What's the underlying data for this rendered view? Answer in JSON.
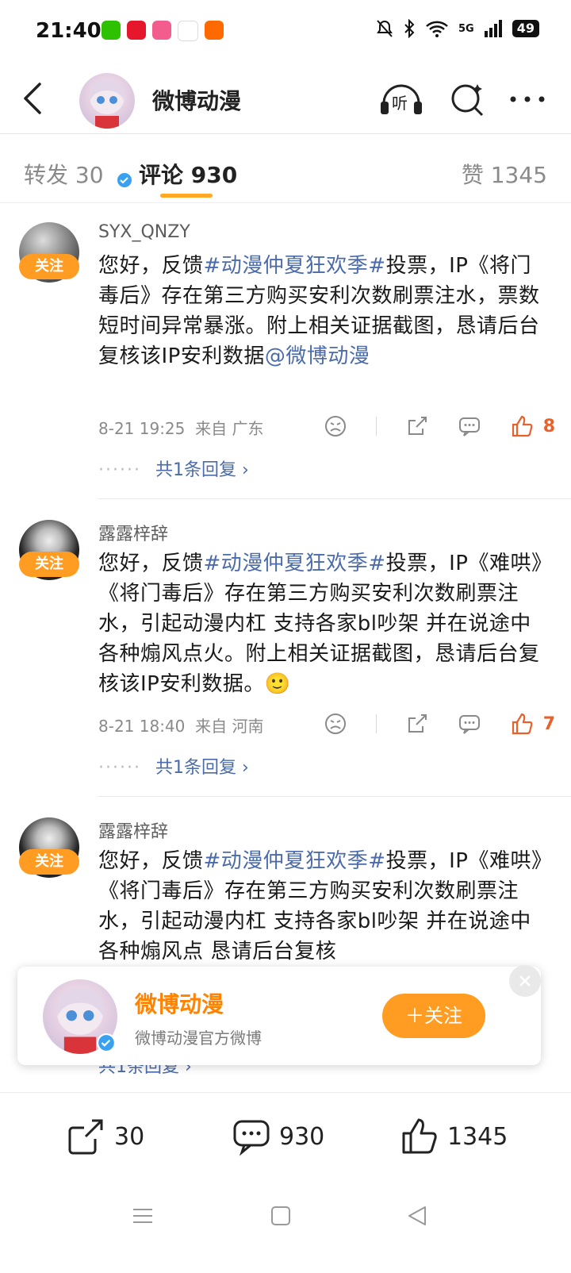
{
  "status_bar": {
    "time": "21:40",
    "network": "5G",
    "battery": "49",
    "icons": [
      "mute-icon",
      "bluetooth-icon",
      "wifi-icon",
      "signal-icon"
    ]
  },
  "nav": {
    "title": "微博动漫",
    "listen_label": "听"
  },
  "tabs": {
    "repost": "转发 30",
    "comment": "评论 930",
    "like": "赞 1345"
  },
  "comments": [
    {
      "follow": "关注",
      "name": "SYX_QNZY",
      "text_before": "您好，反馈",
      "hashtag": "#动漫仲夏狂欢季#",
      "text_after": "投票，IP《将门毒后》存在第三方购买安利次数刷票注水，票数短时间异常暴涨。附上相关证据截图，恳请后台复核该IP安利数据",
      "mention": "@微博动漫",
      "time": "8-21 19:25",
      "location": "来自 广东",
      "likes": "8",
      "reply": "共1条回复 ›"
    },
    {
      "follow": "关注",
      "name": "露露梓辞",
      "text_before": "您好，反馈",
      "hashtag": "#动漫仲夏狂欢季#",
      "text_after": "投票，IP《难哄》《将门毒后》存在第三方购买安利次数刷票注水，引起动漫内杠 支持各家bl吵架 并在说途中各种煽风点火。附上相关证据截图，恳请后台复核该IP安利数据。",
      "mention": "🙂",
      "time": "8-21 18:40",
      "location": "来自 河南",
      "likes": "7",
      "reply": "共1条回复 ›"
    },
    {
      "follow": "关注",
      "name": "露露梓辞",
      "text_before": "您好，反馈",
      "hashtag": "#动漫仲夏狂欢季#",
      "text_after": "投票，IP《难哄》《将门毒后》存在第三方购买安利次数刷票注水，引起动漫内杠 支持各家bl吵架 并在说途中各种煽风点 恳请后台复核",
      "reply": "共1条回复 ›"
    }
  ],
  "follow_card": {
    "name": "微博动漫",
    "subtitle": "微博动漫官方微博",
    "follow_button": "＋关注"
  },
  "bottom_bar": {
    "repost_count": "30",
    "comment_count": "930",
    "like_count": "1345"
  },
  "colors": {
    "accent": "#ff9c21",
    "link": "#4b6baa",
    "like": "#e8612c"
  }
}
